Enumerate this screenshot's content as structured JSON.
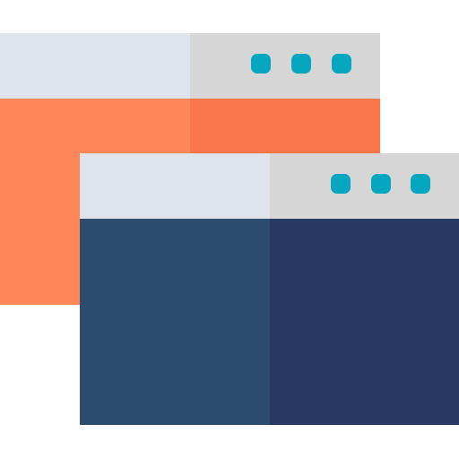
{
  "icon": {
    "name": "multiple-browser-windows-icon",
    "colors": {
      "background": "#ffffff",
      "back_window_titlebar_left": "#dfe3ea",
      "back_window_titlebar_right": "#d6d6d6",
      "back_window_body_left": "#ff8659",
      "back_window_body_right": "#fb754b",
      "front_window_titlebar_left": "#dfe3ea",
      "front_window_titlebar_right": "#d6d6d6",
      "front_window_body_left": "#2e4d6e",
      "front_window_body_right": "#283a63",
      "window_control_dots": "#05a6bf"
    }
  }
}
